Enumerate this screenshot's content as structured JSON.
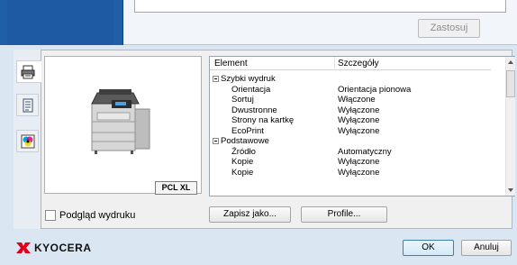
{
  "top": {
    "apply_label": "Zastosuj"
  },
  "preview": {
    "badge": "PCL XL",
    "checkbox_label": "Podgląd wydruku"
  },
  "details": {
    "columns": [
      "Element",
      "Szczegóły"
    ],
    "rows": [
      {
        "element": "Szybki wydruk",
        "detail": "",
        "group": true
      },
      {
        "element": "Orientacja",
        "detail": "Orientacja pionowa",
        "group": false
      },
      {
        "element": "Sortuj",
        "detail": "Włączone",
        "group": false
      },
      {
        "element": "Dwustronne",
        "detail": "Wyłączone",
        "group": false
      },
      {
        "element": "Strony na kartkę",
        "detail": "Wyłączone",
        "group": false
      },
      {
        "element": "EcoPrint",
        "detail": "Wyłączone",
        "group": false
      },
      {
        "element": "Podstawowe",
        "detail": "",
        "group": true
      },
      {
        "element": "Źródło",
        "detail": "Automatyczny",
        "group": false
      },
      {
        "element": "Kopie",
        "detail": "Wyłączone",
        "group": false
      },
      {
        "element": "Kopie",
        "detail": "Wyłączone",
        "group": false
      }
    ]
  },
  "buttons": {
    "save_as": "Zapisz jako...",
    "profile": "Profile...",
    "ok": "OK",
    "cancel": "Anuluj"
  },
  "logo": {
    "text": "KYOCERA",
    "brand_color": "#e2001a"
  },
  "icons": [
    "printer-icon",
    "document-icon",
    "color-icon",
    "kyocera-logo-icon",
    "scroll-up-icon",
    "scroll-down-icon"
  ]
}
